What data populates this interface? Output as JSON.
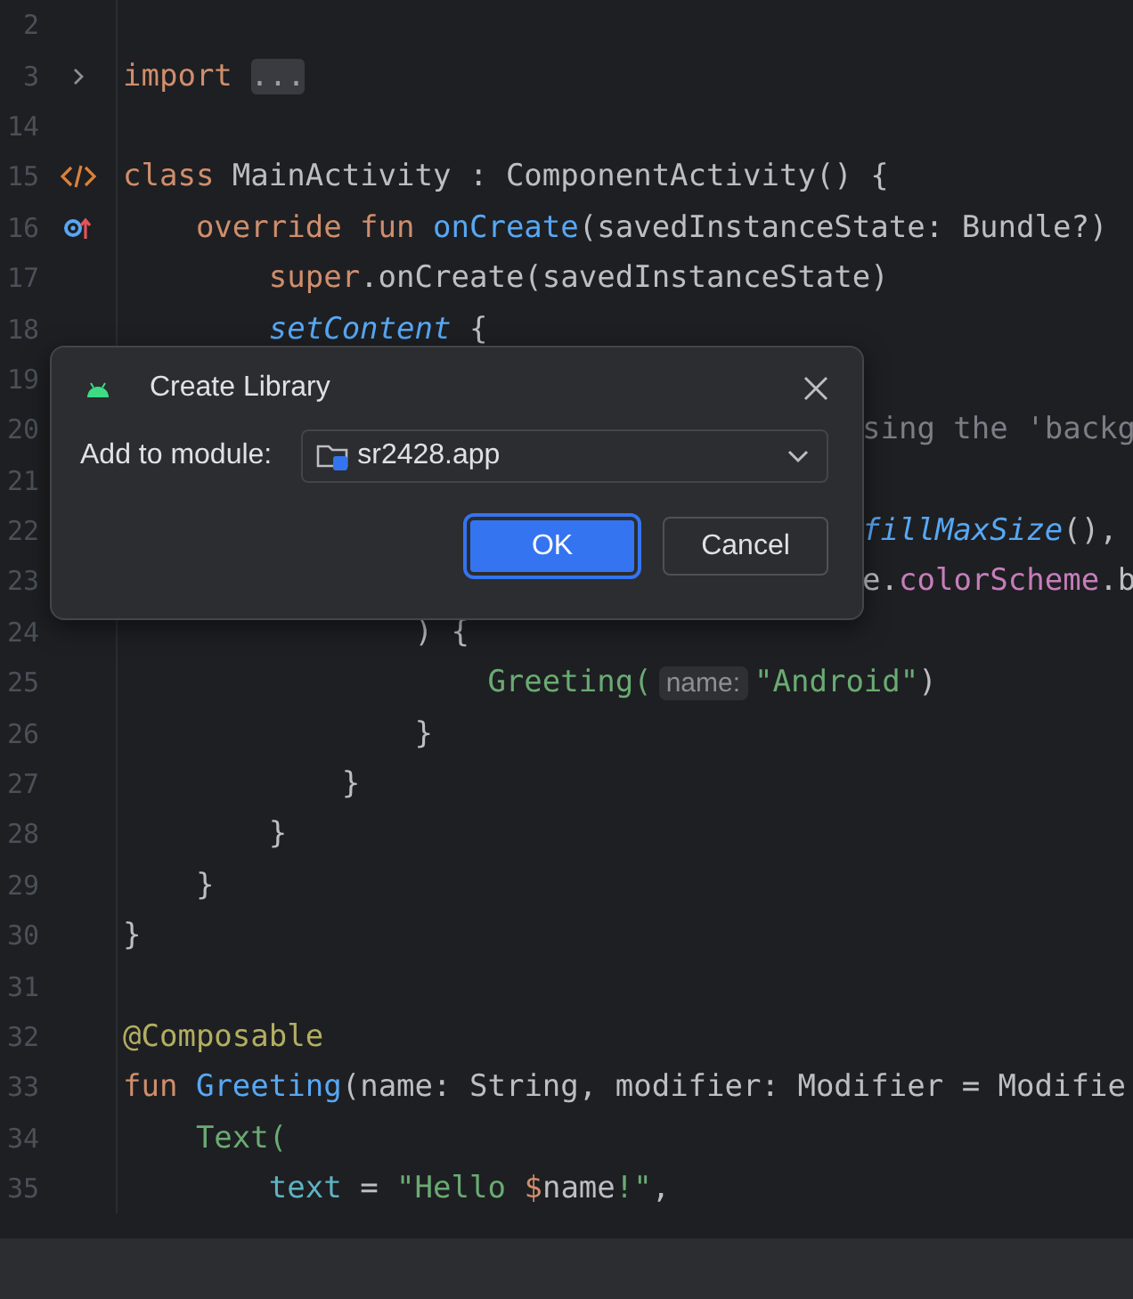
{
  "editor": {
    "lines": [
      {
        "number": "2"
      },
      {
        "number": "3",
        "marker": {
          "kind": "fold"
        },
        "tokens": [
          {
            "text": "import ",
            "kind": "kw"
          },
          {
            "text": "...",
            "kind": "fold"
          }
        ]
      },
      {
        "number": "14"
      },
      {
        "number": "15",
        "marker": {
          "kind": "composable"
        },
        "tokens": [
          {
            "text": "class ",
            "kind": "kw"
          },
          {
            "text": "MainActivity : ComponentActivity() {",
            "kind": "plain"
          }
        ]
      },
      {
        "number": "16",
        "marker": {
          "kind": "override"
        },
        "tokens": [
          {
            "text": "    override fun ",
            "kind": "kw"
          },
          {
            "text": "onCreate",
            "kind": "fn"
          },
          {
            "text": "(savedInstanceState: Bundle?)",
            "kind": "plain"
          }
        ]
      },
      {
        "number": "17",
        "tokens": [
          {
            "text": "        super",
            "kind": "kw"
          },
          {
            "text": ".onCreate(savedInstanceState)",
            "kind": "plain"
          }
        ]
      },
      {
        "number": "18",
        "tokens": [
          {
            "text": "        setContent",
            "kind": "fni"
          },
          {
            "text": " {",
            "kind": "plain"
          }
        ]
      },
      {
        "number": "19"
      },
      {
        "number": "20",
        "covered": true,
        "tokens": [
          {
            "text": "sing the 'backg",
            "kind": "comment"
          }
        ]
      },
      {
        "number": "21"
      },
      {
        "number": "22",
        "covered": true,
        "tokens": [
          {
            "text": "fillMaxSize",
            "kind": "fni"
          },
          {
            "text": "(),",
            "kind": "plain"
          }
        ]
      },
      {
        "number": "23",
        "covered": true,
        "tokens": [
          {
            "text": "e.",
            "kind": "plain"
          },
          {
            "text": "colorScheme",
            "kind": "prop"
          },
          {
            "text": ".b",
            "kind": "plain"
          }
        ]
      },
      {
        "number": "24",
        "tokens": [
          {
            "text": "                ) {",
            "kind": "plain"
          }
        ]
      },
      {
        "number": "25",
        "tokens": [
          {
            "text": "                    Greeting(",
            "kind": "call"
          },
          {
            "text": "name:",
            "kind": "hint"
          },
          {
            "text": "\"Android\"",
            "kind": "str"
          },
          {
            "text": ")",
            "kind": "plain"
          }
        ]
      },
      {
        "number": "26",
        "tokens": [
          {
            "text": "                }",
            "kind": "plain"
          }
        ]
      },
      {
        "number": "27",
        "tokens": [
          {
            "text": "            }",
            "kind": "plain"
          }
        ]
      },
      {
        "number": "28",
        "tokens": [
          {
            "text": "        }",
            "kind": "plain"
          }
        ]
      },
      {
        "number": "29",
        "tokens": [
          {
            "text": "    }",
            "kind": "plain"
          }
        ]
      },
      {
        "number": "30",
        "tokens": [
          {
            "text": "}",
            "kind": "plain"
          }
        ]
      },
      {
        "number": "31"
      },
      {
        "number": "32",
        "tokens": [
          {
            "text": "@Composable",
            "kind": "ann"
          }
        ]
      },
      {
        "number": "33",
        "tokens": [
          {
            "text": "fun ",
            "kind": "kw"
          },
          {
            "text": "Greeting",
            "kind": "fn"
          },
          {
            "text": "(name: String, modifier: Modifier = Modifie",
            "kind": "plain"
          }
        ]
      },
      {
        "number": "34",
        "tokens": [
          {
            "text": "    Text(",
            "kind": "call"
          }
        ]
      },
      {
        "number": "35",
        "tokens": [
          {
            "text": "        text",
            "kind": "param"
          },
          {
            "text": " = ",
            "kind": "plain"
          },
          {
            "text": "\"Hello ",
            "kind": "str"
          },
          {
            "text": "$",
            "kind": "kw"
          },
          {
            "text": "name",
            "kind": "plain"
          },
          {
            "text": "!\"",
            "kind": "str"
          },
          {
            "text": ",",
            "kind": "plain"
          }
        ]
      }
    ]
  },
  "dialog": {
    "title": "Create Library",
    "field_label": "Add to module:",
    "module": "sr2428.app",
    "buttons": [
      {
        "label": "OK",
        "default": true
      },
      {
        "label": "Cancel",
        "default": false
      }
    ]
  }
}
